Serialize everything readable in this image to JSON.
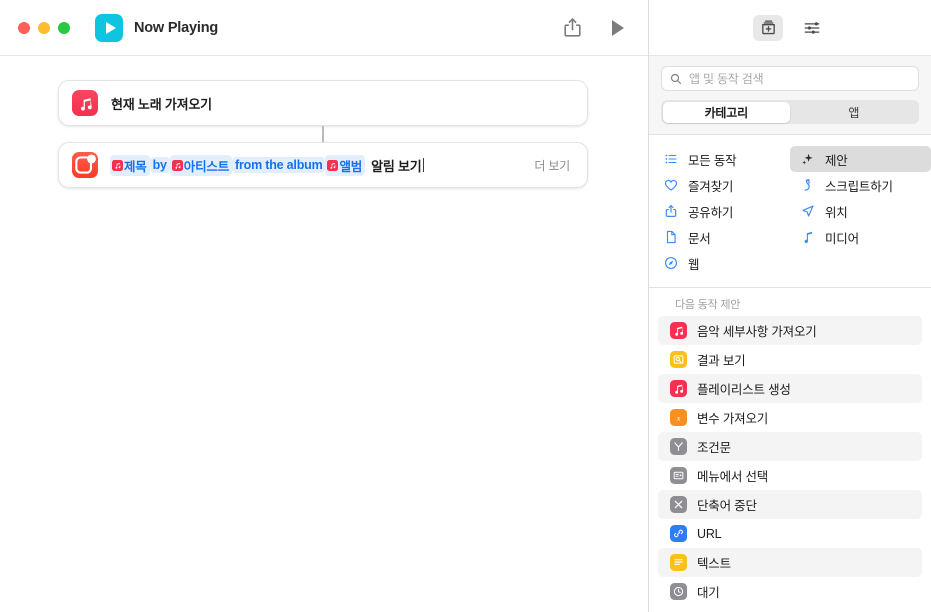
{
  "window": {
    "title": "Now Playing",
    "app_icon": "play-icon",
    "traffic_lights": [
      "close-red",
      "minimize-yellow",
      "zoom-green"
    ],
    "toolbar": {
      "share_label": "share-icon",
      "run_label": "play-icon"
    }
  },
  "editor": {
    "actions": [
      {
        "icon": "music-note-icon",
        "icon_color": "#f7304f",
        "title": "현재 노래 가져오기",
        "more_label": ""
      },
      {
        "icon": "alert-badge-icon",
        "icon_color": "#fc3b28",
        "tokens": [
          {
            "type": "variable",
            "label": "제목",
            "icon": "music-note-icon"
          },
          {
            "type": "text",
            "label": "by"
          },
          {
            "type": "variable",
            "label": "아티스트",
            "icon": "music-note-icon"
          },
          {
            "type": "text",
            "label": "from the album"
          },
          {
            "type": "variable",
            "label": "앨범",
            "icon": "music-note-icon"
          }
        ],
        "trailing_text": "알림 보기",
        "more_label": "더 보기"
      }
    ]
  },
  "sidebar": {
    "toolbar_buttons": [
      {
        "name": "action-library-button",
        "icon": "add-action-icon",
        "active": true
      },
      {
        "name": "shortcut-details-button",
        "icon": "sliders-icon",
        "active": false
      }
    ],
    "search": {
      "placeholder": "앱 및 동작 검색",
      "icon": "search-icon",
      "value": ""
    },
    "segmented": {
      "options": [
        "카테고리",
        "앱"
      ],
      "selected": "카테고리"
    },
    "categories_left": [
      {
        "label": "모든 동작",
        "icon": "list-bullet-icon"
      },
      {
        "label": "즐겨찾기",
        "icon": "heart-icon"
      },
      {
        "label": "공유하기",
        "icon": "share-icon"
      },
      {
        "label": "문서",
        "icon": "document-icon"
      },
      {
        "label": "웹",
        "icon": "compass-icon"
      }
    ],
    "categories_right": [
      {
        "label": "제안",
        "icon": "sparkles-icon",
        "selected": true
      },
      {
        "label": "스크립트하기",
        "icon": "script-icon",
        "selected": false
      },
      {
        "label": "위치",
        "icon": "location-arrow-icon",
        "selected": false
      },
      {
        "label": "미디어",
        "icon": "music-note-icon",
        "selected": false
      }
    ],
    "suggestions_header": "다음 동작 제안",
    "suggestions": [
      {
        "label": "음악 세부사항 가져오기",
        "icon": "music-note-icon",
        "icon_color": "#f7304f"
      },
      {
        "label": "결과 보기",
        "icon": "quicklook-icon",
        "icon_color": "#fcc01c"
      },
      {
        "label": "플레이리스트 생성",
        "icon": "music-note-icon",
        "icon_color": "#f7304f"
      },
      {
        "label": "변수 가져오기",
        "icon": "variable-icon",
        "icon_color": "#f79021"
      },
      {
        "label": "조건문",
        "icon": "branch-icon",
        "icon_color": "#8e8e93"
      },
      {
        "label": "메뉴에서 선택",
        "icon": "menu-icon",
        "icon_color": "#8e8e93"
      },
      {
        "label": "단축어 중단",
        "icon": "x-icon",
        "icon_color": "#8e8e93"
      },
      {
        "label": "URL",
        "icon": "link-icon",
        "icon_color": "#2f7cf6"
      },
      {
        "label": "텍스트",
        "icon": "text-lines-icon",
        "icon_color": "#fcc01c"
      },
      {
        "label": "대기",
        "icon": "clock-icon",
        "icon_color": "#8e8e93"
      }
    ]
  },
  "colors": {
    "accent_blue": "#3d8bfd",
    "token_blue": "#1272ef",
    "token_bg": "#e3eefc",
    "app_cyan": "#0fc4de"
  }
}
